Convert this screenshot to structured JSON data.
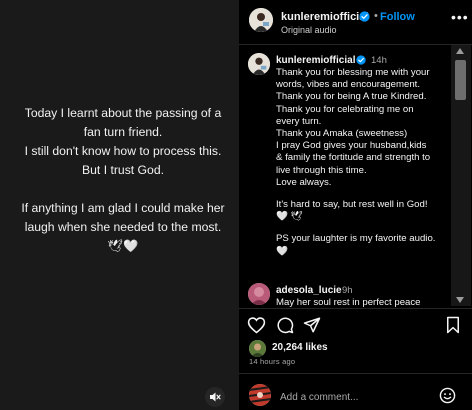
{
  "story": {
    "lines": [
      "Today I learnt about the passing of a",
      "fan turn friend.",
      "I still don't know how to process this.",
      "But I trust God."
    ],
    "lines2": [
      "If anything I am glad I could make her",
      "laugh when she needed to the most."
    ],
    "emoji_line": "🕊🤍"
  },
  "header": {
    "username": "kunleremiofficial",
    "separator": "•",
    "follow_label": "Follow",
    "subtitle": "Original audio",
    "more": "•••"
  },
  "caption": {
    "username": "kunleremiofficial",
    "time": "14h",
    "paragraphs": [
      [
        "Thank you for blessing me with your",
        "words, vibes and encouragement.",
        "Thank you for being A true Kindred.",
        "Thank you for celebrating me on",
        "every turn.",
        "Thank you Amaka (sweetness)",
        "I pray God gives your husband,kids",
        "& family the fortitude and strength to",
        "live through this time.",
        "Love always."
      ],
      [
        "It's hard to say, but rest well in God!",
        "🤍 🕊"
      ],
      [
        "PS your laughter is my favorite audio.",
        "🤍"
      ]
    ]
  },
  "comment": {
    "username": "adesola_lucie",
    "time": "9h",
    "text": "May her soul rest in perfect peace"
  },
  "likes": "20,264 likes",
  "post_time": "14 hours ago",
  "add_comment_placeholder": "Add a comment...",
  "colors": {
    "accent": "#0095f6",
    "verified": "#0095f6",
    "background": "#000000",
    "media_bg": "#1a1a1a"
  },
  "icons": {
    "mute": "speaker-muted-icon",
    "like": "heart-icon",
    "comment": "comment-bubble-icon",
    "share": "paper-plane-icon",
    "save": "bookmark-icon",
    "emoji": "smiley-icon",
    "more": "more-options-icon"
  }
}
